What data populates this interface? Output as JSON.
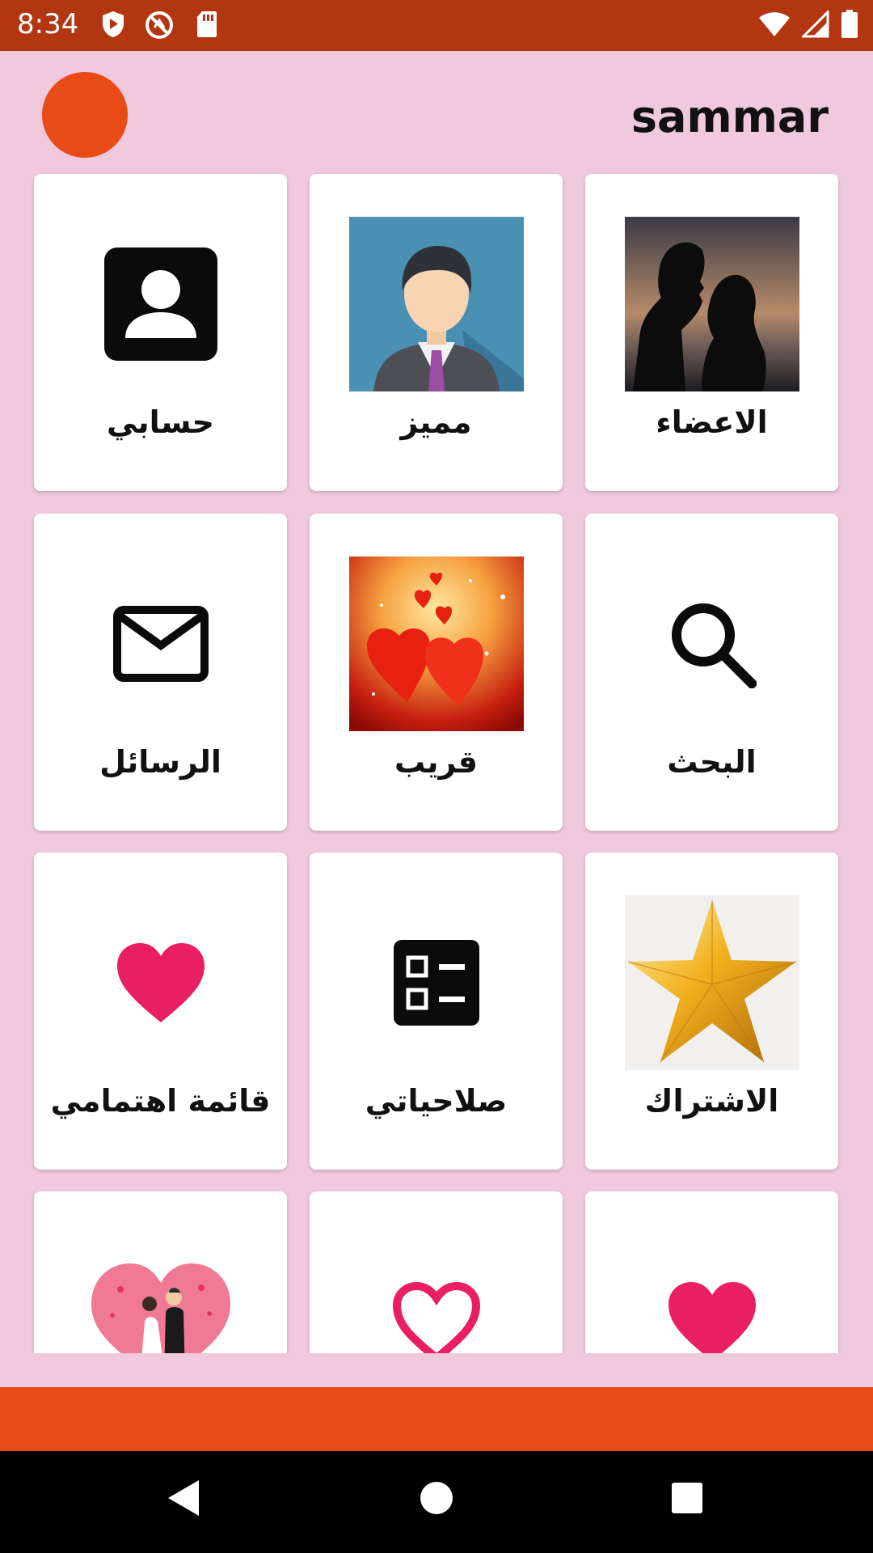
{
  "status_bar": {
    "time": "8:34",
    "left_icons": [
      "play-protect-icon",
      "no-sync-icon",
      "sd-card-icon"
    ],
    "right_icons": [
      "wifi-icon",
      "signal-icon",
      "battery-icon"
    ]
  },
  "header": {
    "title": "sammar",
    "avatar_color": "#e94b17"
  },
  "grid": {
    "items": [
      {
        "label": "الاعضاء",
        "icon": "couple-silhouette-photo"
      },
      {
        "label": "مميز",
        "icon": "businessman-avatar-image"
      },
      {
        "label": "حسابي",
        "icon": "account-box-icon"
      },
      {
        "label": "البحث",
        "icon": "search-icon"
      },
      {
        "label": "قريب",
        "icon": "hearts-sparkle-image"
      },
      {
        "label": "الرسائل",
        "icon": "mail-icon"
      },
      {
        "label": "الاشتراك",
        "icon": "gold-star-image"
      },
      {
        "label": "صلاحياتي",
        "icon": "checklist-icon"
      },
      {
        "label": "قائمة اهتمامي",
        "icon": "heart-filled-icon"
      },
      {
        "label": "",
        "icon": "heart-filled-icon"
      },
      {
        "label": "",
        "icon": "heart-outline-icon"
      },
      {
        "label": "",
        "icon": "wedding-couple-heart-image"
      }
    ]
  },
  "colors": {
    "status_bar": "#b2360f",
    "background": "#f0c9dc",
    "accent": "#e94b17",
    "heart": "#e91e63"
  },
  "nav_bar": {
    "buttons": [
      "back-icon",
      "home-icon",
      "recents-icon"
    ]
  }
}
